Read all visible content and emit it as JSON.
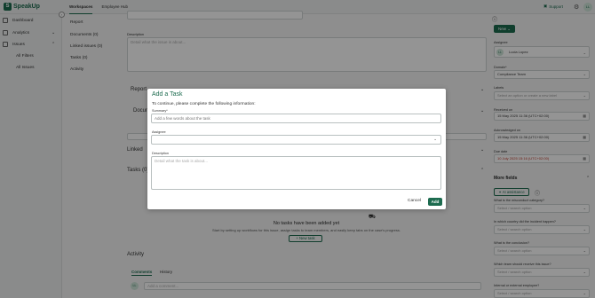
{
  "app": {
    "brand": "SpeakUp",
    "brand_letter": "S"
  },
  "topnav": {
    "workspaces": "Workspaces",
    "employee_hub": "Employee Hub",
    "support": "Support",
    "support_icon": "chat-icon",
    "avatar": "LL"
  },
  "sidebar": {
    "dashboard": "Dashboard",
    "analytics": "Analytics",
    "issues": "Issues",
    "all_filters": "All Filters",
    "all_issues": "All Issues"
  },
  "subnav": {
    "report": "Report",
    "documents": "Documents (0)",
    "linked_issues": "Linked issues (0)",
    "tasks": "Tasks (0)",
    "activity": "Activity"
  },
  "main": {
    "description_label": "Description",
    "description_placeholder": "Detail what the issue is about...",
    "report_title": "Report",
    "documents_title": "Documents",
    "linked_title": "Linked",
    "tasks_title": "Tasks (0)",
    "no_tasks_title": "No tasks have been added yet",
    "no_tasks_sub": "Start by setting up workflows for this issue, assign tasks to team members, and easily keep tabs on the case's progress.",
    "new_task_button": "+ New task",
    "activity_title": "Activity",
    "tab_comments": "Comments",
    "tab_history": "History",
    "comment_avatar": "LL",
    "comment_placeholder": "Add a comment..."
  },
  "rightpanel": {
    "new_button": "New",
    "assignee_label": "Assignee",
    "assignee_value": "Lucia Lopez",
    "assignee_initials": "LL",
    "domain_label": "Domain*",
    "domain_value": "Compliance Team",
    "labels_label": "Labels",
    "labels_placeholder": "Select an option or create a new label",
    "received_label": "Received on",
    "received_value": "15 May 2025 11:36 (UTC+02:00)",
    "ack_label": "Acknowledged on",
    "ack_value": "15 May 2025 11:36 (UTC+02:00)",
    "due_label": "Due date",
    "due_value": "10 July 2025 15:16 (UTC+02:00)",
    "more_fields": "More fields",
    "ai_assistance": "AI assistance",
    "q1": "What is the misconduct category?",
    "q2": "In which country did the incident happen?",
    "q3": "What is the conclusion?",
    "q4": "Which team should receive this issue?",
    "q5": "Internal or external employee?",
    "select_placeholder": "Select / search option"
  },
  "modal": {
    "title": "Add a Task",
    "subtitle": "To continue, please complete the following information:",
    "summary_label": "Summary*",
    "summary_placeholder": "Add a few words about the task",
    "assignee_label": "Assignee",
    "description_label": "Description",
    "description_placeholder": "Detail what the task is about...",
    "cancel": "Cancel",
    "add": "Add"
  },
  "colors": {
    "brand_green": "#1d6b4f",
    "due_red": "#c0392b"
  }
}
